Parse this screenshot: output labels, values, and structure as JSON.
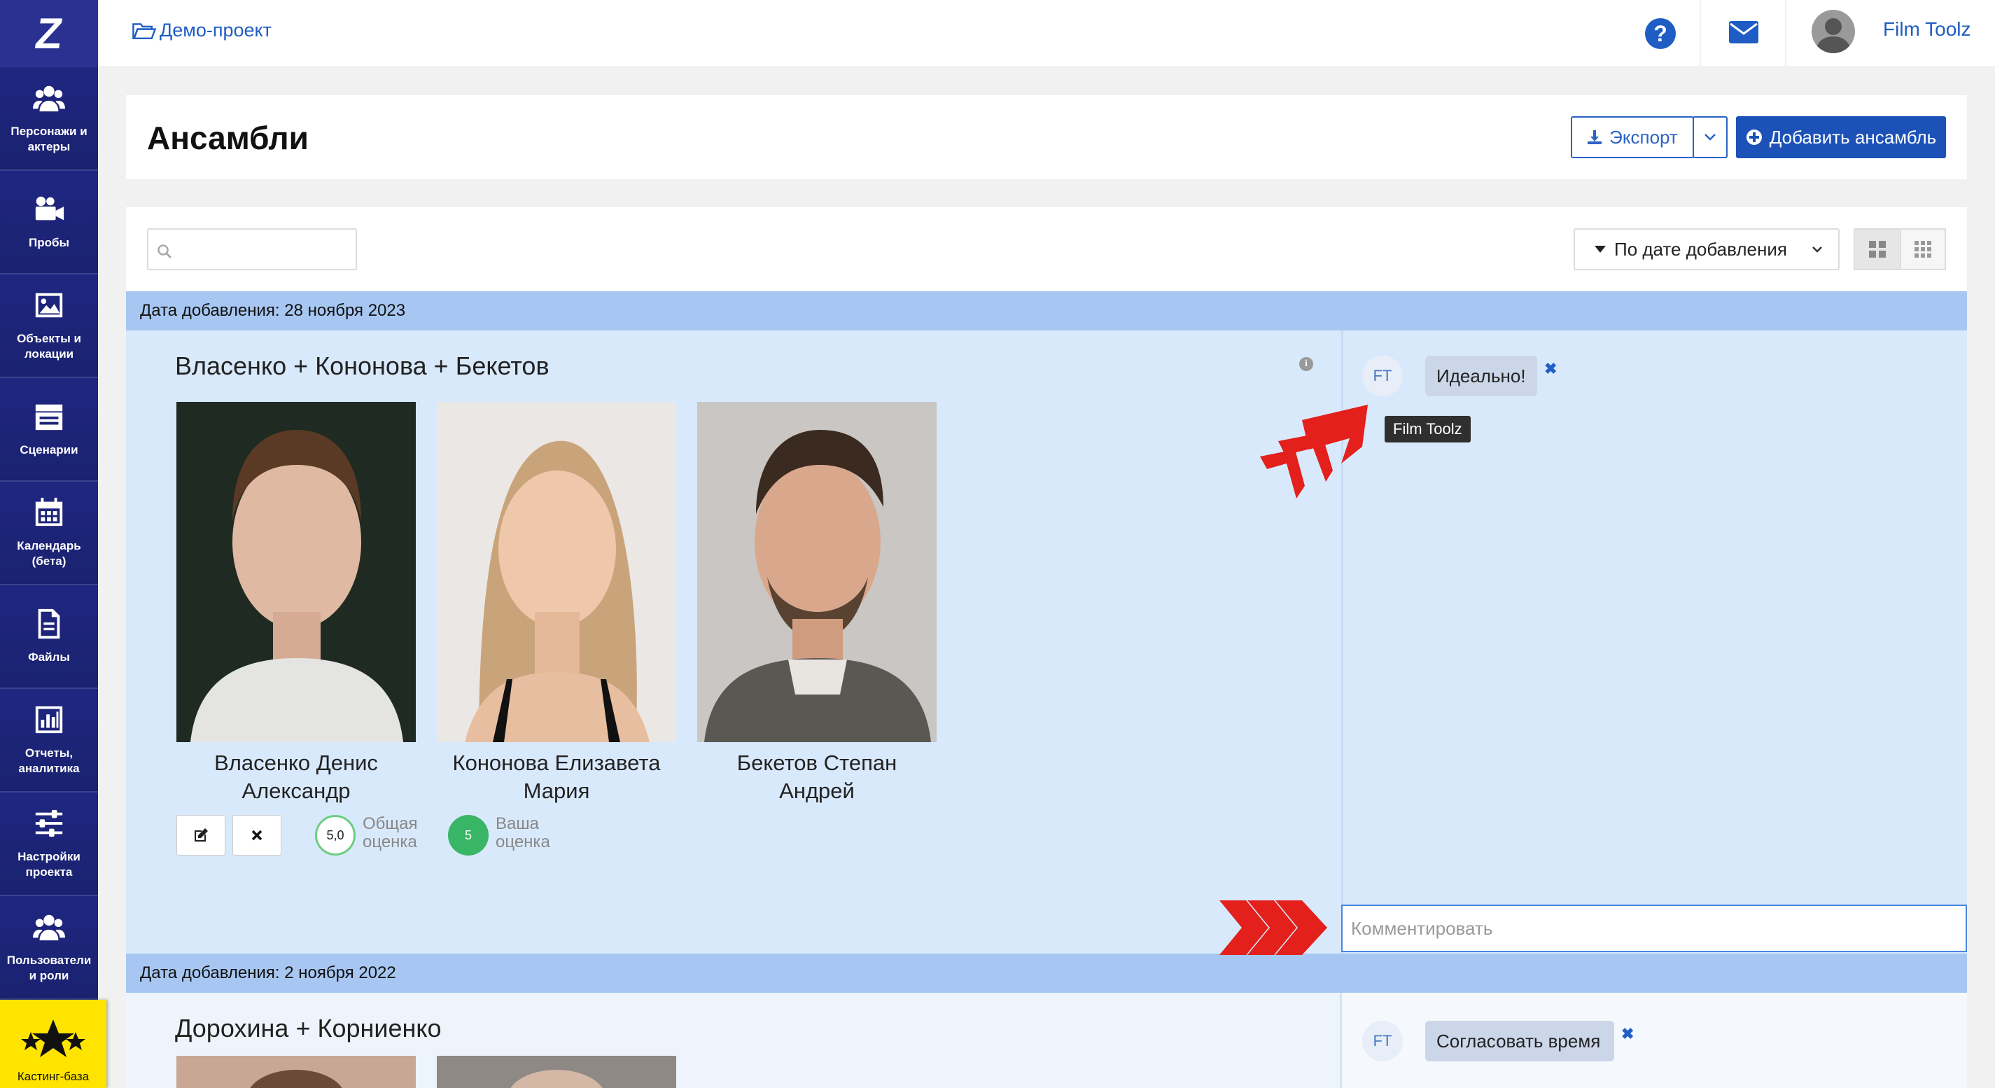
{
  "sidebar": {
    "logo": "Z",
    "items": [
      {
        "label": "Персонажи и актеры",
        "icon": "users-icon"
      },
      {
        "label": "Пробы",
        "icon": "video-camera-icon"
      },
      {
        "label": "Объекты и локации",
        "icon": "image-icon"
      },
      {
        "label": "Сценарии",
        "icon": "clapperboard-icon"
      },
      {
        "label": "Календарь (бета)",
        "icon": "calendar-icon"
      },
      {
        "label": "Файлы",
        "icon": "file-icon"
      },
      {
        "label": "Отчеты, аналитика",
        "icon": "bar-chart-icon"
      },
      {
        "label": "Настройки проекта",
        "icon": "sliders-icon"
      },
      {
        "label": "Пользователи и роли",
        "icon": "users-icon"
      }
    ],
    "casting": {
      "label": "Кастинг-база",
      "icon": "stars-icon"
    }
  },
  "topbar": {
    "breadcrumb": "Демо-проект",
    "help_icon": "?",
    "user_name": "Film Toolz"
  },
  "header": {
    "title": "Ансамбли",
    "export_label": "Экспорт",
    "add_label": "Добавить ансамбль"
  },
  "toolbar": {
    "search_value": "",
    "sort_label": "По дате добавления"
  },
  "groups": [
    {
      "date_label": "Дата добавления: 28 ноября 2023",
      "ensemble": {
        "title": "Власенко + Кононова + Бекетов",
        "actors": [
          {
            "name_line1": "Власенко Денис",
            "name_line2": "Александр"
          },
          {
            "name_line1": "Кононова Елизавета",
            "name_line2": "Мария"
          },
          {
            "name_line1": "Бекетов Степан",
            "name_line2": "Андрей"
          }
        ],
        "total_score": "5,0",
        "total_label_1": "Общая",
        "total_label_2": "оценка",
        "my_score": "5",
        "my_label_1": "Ваша",
        "my_label_2": "оценка",
        "comment": {
          "author_initials": "FT",
          "text": "Идеально!",
          "tooltip": "Film Toolz"
        },
        "comment_placeholder": "Комментировать"
      }
    },
    {
      "date_label": "Дата добавления: 2 ноября 2022",
      "ensemble": {
        "title": "Дорохина + Корниенко",
        "comment": {
          "author_initials": "FT",
          "text": "Согласовать время"
        }
      }
    }
  ],
  "colors": {
    "sidebar": "#1c2475",
    "accent": "#1c52b8",
    "date_bar": "#a7c7f2",
    "ensemble_bg": "#d9e9fc",
    "casting": "#ffe400",
    "annotation_arrow": "#e3201b"
  }
}
